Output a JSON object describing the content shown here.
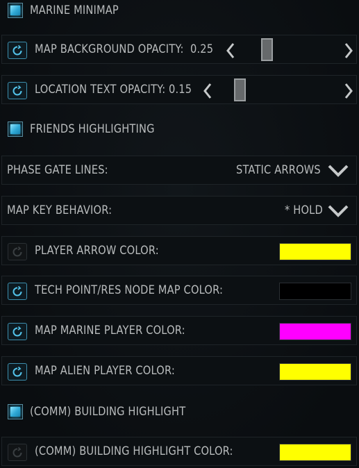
{
  "marine_minimap": {
    "label": "MARINE MINIMAP",
    "checked": true
  },
  "map_background_opacity": {
    "label": "MAP BACKGROUND OPACITY:",
    "value": "0.25",
    "slider_level": 0.25
  },
  "location_text_opacity": {
    "label": "LOCATION TEXT OPACITY:",
    "value": "0.15",
    "slider_level": 0.15
  },
  "friends_highlighting": {
    "label": "FRIENDS HIGHLIGHTING",
    "checked": true
  },
  "phase_gate_lines": {
    "label": "PHASE GATE LINES:",
    "selected": "STATIC ARROWS"
  },
  "map_key_behavior": {
    "label": "MAP KEY BEHAVIOR:",
    "selected": "* HOLD"
  },
  "player_arrow_color": {
    "label": "PLAYER ARROW COLOR:",
    "color": "#ffff00",
    "reset_enabled": false
  },
  "tech_point_color": {
    "label": "TECH POINT/RES NODE MAP COLOR:",
    "color": "#000000",
    "reset_enabled": true
  },
  "map_marine_player_color": {
    "label": "MAP MARINE PLAYER COLOR:",
    "color": "#ff00ff",
    "reset_enabled": true
  },
  "map_alien_player_color": {
    "label": "MAP ALIEN PLAYER COLOR:",
    "color": "#ffff00",
    "reset_enabled": true
  },
  "comm_building_highlight": {
    "label": "(COMM) BUILDING HIGHLIGHT",
    "checked": true
  },
  "comm_building_highlight_color": {
    "label": "(COMM) BUILDING HIGHLIGHT COLOR:",
    "color": "#ffff00",
    "reset_enabled": false
  },
  "icons": {
    "reset": "reset-icon",
    "left_arrow": "chevron-left-icon",
    "right_arrow": "chevron-right-icon",
    "dropdown": "chevron-down-icon"
  },
  "colors": {
    "accent": "#2fa9d6",
    "text": "#b9bcbd",
    "panel_border": "#1e2428"
  }
}
